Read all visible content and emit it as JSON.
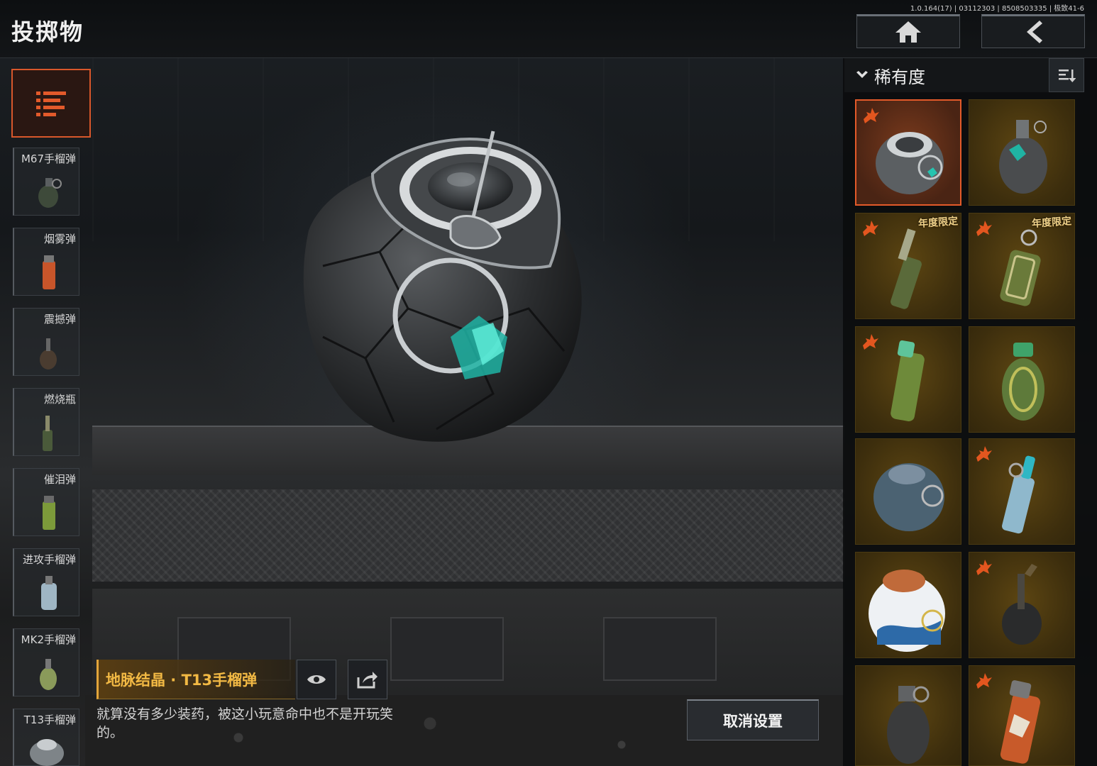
{
  "header": {
    "title": "投掷物",
    "version": "1.0.164(17) | 03112303 | 8508503335 | 极致41-6",
    "home_icon": "home-icon",
    "back_icon": "back-arrow-icon"
  },
  "categories": [
    {
      "label": "M67手榴弹"
    },
    {
      "label": "烟雾弹"
    },
    {
      "label": "震撼弹"
    },
    {
      "label": "燃烧瓶"
    },
    {
      "label": "催泪弹"
    },
    {
      "label": "进攻手榴弹"
    },
    {
      "label": "MK2手榴弹"
    },
    {
      "label": "T13手榴弹"
    }
  ],
  "featured": {
    "name": "地脉结晶 · T13手榴弹",
    "description": "就算没有多少装药，被这小玩意命中也不是开玩笑的。",
    "cancel_label": "取消设置",
    "preview_icon": "eye-icon",
    "share_icon": "share-icon"
  },
  "sort": {
    "label": "稀有度",
    "icon": "sort-icon"
  },
  "skins": [
    {
      "selected": true,
      "flame": true,
      "limited": ""
    },
    {
      "selected": false,
      "flame": false,
      "limited": ""
    },
    {
      "selected": false,
      "flame": true,
      "limited": "年度限定"
    },
    {
      "selected": false,
      "flame": true,
      "limited": "年度限定"
    },
    {
      "selected": false,
      "flame": true,
      "limited": ""
    },
    {
      "selected": false,
      "flame": false,
      "limited": ""
    },
    {
      "selected": false,
      "flame": false,
      "limited": ""
    },
    {
      "selected": false,
      "flame": true,
      "limited": ""
    },
    {
      "selected": false,
      "flame": false,
      "limited": ""
    },
    {
      "selected": false,
      "flame": true,
      "limited": ""
    },
    {
      "selected": false,
      "flame": false,
      "limited": ""
    },
    {
      "selected": false,
      "flame": true,
      "limited": ""
    }
  ],
  "colors": {
    "accent": "#d8572b",
    "gold": "#f2b944",
    "cell_bg": "#3d2e0d"
  }
}
